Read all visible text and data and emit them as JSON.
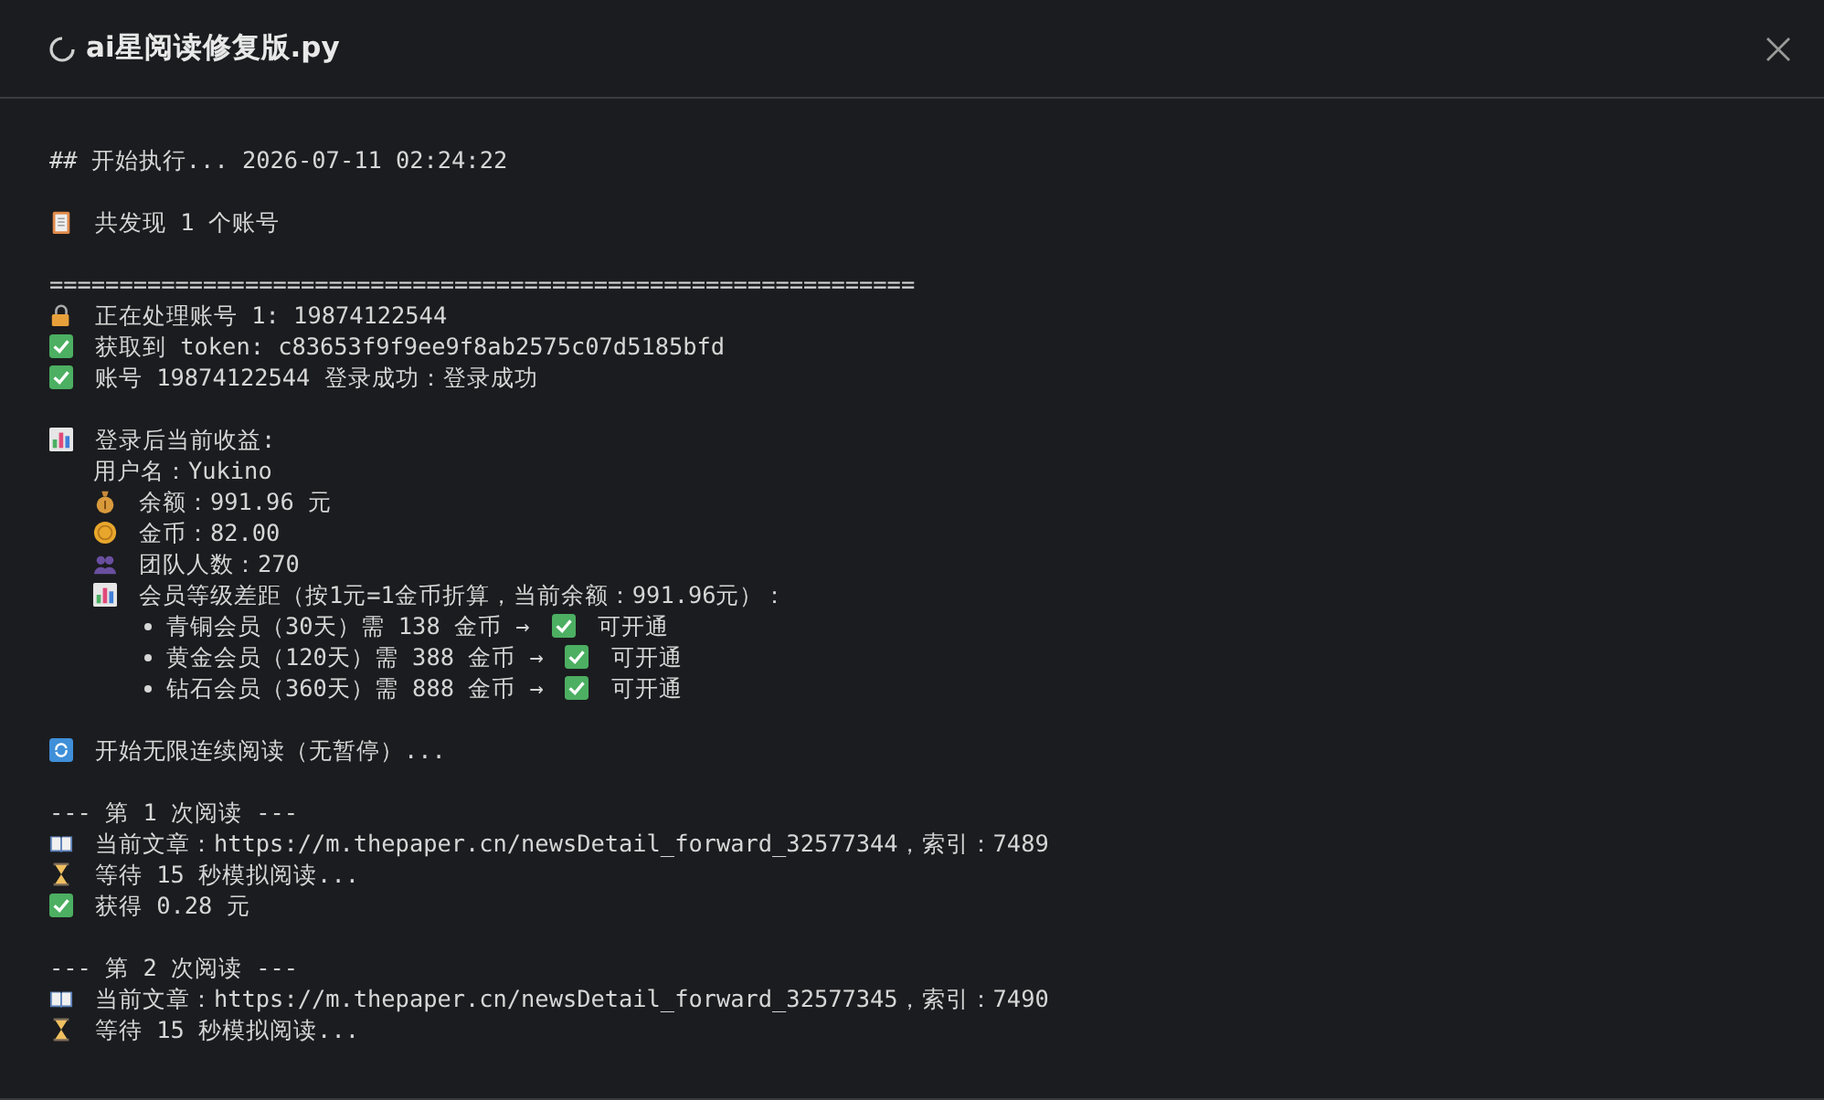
{
  "window": {
    "title": "ai星阅读修复版.py",
    "running": true
  },
  "log": [
    {
      "kind": "header",
      "text": "## 开始执行... 2026-07-11 02:24:22"
    },
    {
      "kind": "blank"
    },
    {
      "kind": "found",
      "text": "共发现 1 个账号"
    },
    {
      "kind": "blank"
    },
    {
      "kind": "divider",
      "text": "=============================================================="
    },
    {
      "kind": "processing",
      "text": "正在处理账号 1: 19874122544"
    },
    {
      "kind": "success",
      "text": "获取到 token: c83653f9f9ee9f8ab2575c07d5185bfd"
    },
    {
      "kind": "success",
      "text": "账号 19874122544 登录成功：登录成功"
    },
    {
      "kind": "blank"
    },
    {
      "kind": "report",
      "text": "登录后当前收益:",
      "children": [
        {
          "kind": "plain",
          "text": "用户名：Yukino"
        },
        {
          "kind": "balance",
          "text": "余额：991.96 元"
        },
        {
          "kind": "coins",
          "text": "金币：82.00"
        },
        {
          "kind": "team",
          "text": "团队人数：270"
        },
        {
          "kind": "report",
          "text": "会员等级差距（按1元=1金币折算，当前余额：991.96元）：",
          "children": [
            {
              "kind": "bullet",
              "text": "青铜会员（30天）需 138 金币 →",
              "status": "可开通",
              "ok": true
            },
            {
              "kind": "bullet",
              "text": "黄金会员（120天）需 388 金币 →",
              "status": "可开通",
              "ok": true
            },
            {
              "kind": "bullet",
              "text": "钻石会员（360天）需 888 金币 →",
              "status": "可开通",
              "ok": true
            }
          ]
        }
      ]
    },
    {
      "kind": "blank"
    },
    {
      "kind": "loop",
      "text": "开始无限连续阅读（无暂停）..."
    },
    {
      "kind": "blank"
    },
    {
      "kind": "plain",
      "text": "--- 第 1 次阅读 ---"
    },
    {
      "kind": "article",
      "text": "当前文章：https://m.thepaper.cn/newsDetail_forward_32577344，索引：7489"
    },
    {
      "kind": "waiting",
      "text": "等待 15 秒模拟阅读..."
    },
    {
      "kind": "success",
      "text": "获得 0.28 元"
    },
    {
      "kind": "blank"
    },
    {
      "kind": "plain",
      "text": "--- 第 2 次阅读 ---"
    },
    {
      "kind": "article",
      "text": "当前文章：https://m.thepaper.cn/newsDetail_forward_32577345，索引：7490"
    },
    {
      "kind": "waiting",
      "text": "等待 15 秒模拟阅读..."
    }
  ]
}
